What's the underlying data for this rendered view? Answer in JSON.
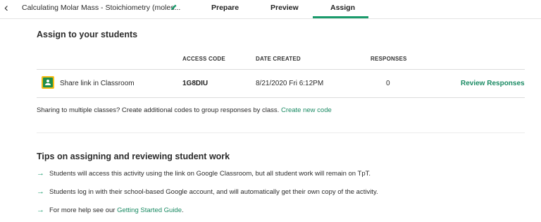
{
  "topbar": {
    "doc_title": "Calculating Molar Mass - Stoichiometry (moles...",
    "tabs": [
      {
        "label": "Prepare"
      },
      {
        "label": "Preview"
      },
      {
        "label": "Assign"
      }
    ],
    "active_tab": "Assign",
    "accent_color": "#1a9b6c"
  },
  "assign": {
    "title": "Assign to your students",
    "columns": [
      "ACCESS CODE",
      "DATE CREATED",
      "RESPONSES"
    ],
    "row": {
      "platform_icon": "google-classroom-icon",
      "label": "Share link in Classroom",
      "access_code": "1G8DIU",
      "date_created": "8/21/2020 Fri 6:12PM",
      "responses": "0",
      "action": "Review Responses"
    },
    "sharing_text": "Sharing to multiple classes? Create additional codes to group responses by class.",
    "sharing_link": "Create new code"
  },
  "tips": {
    "title": "Tips on assigning and reviewing student work",
    "items": [
      {
        "text": "Students will access this activity using the link on Google Classroom, but all student work will remain on TpT."
      },
      {
        "text": "Students log in with their school-based Google account, and will automatically get their own copy of the activity."
      },
      {
        "text": "For more help see our ",
        "link": "Getting Started Guide",
        "suffix": "."
      }
    ]
  }
}
